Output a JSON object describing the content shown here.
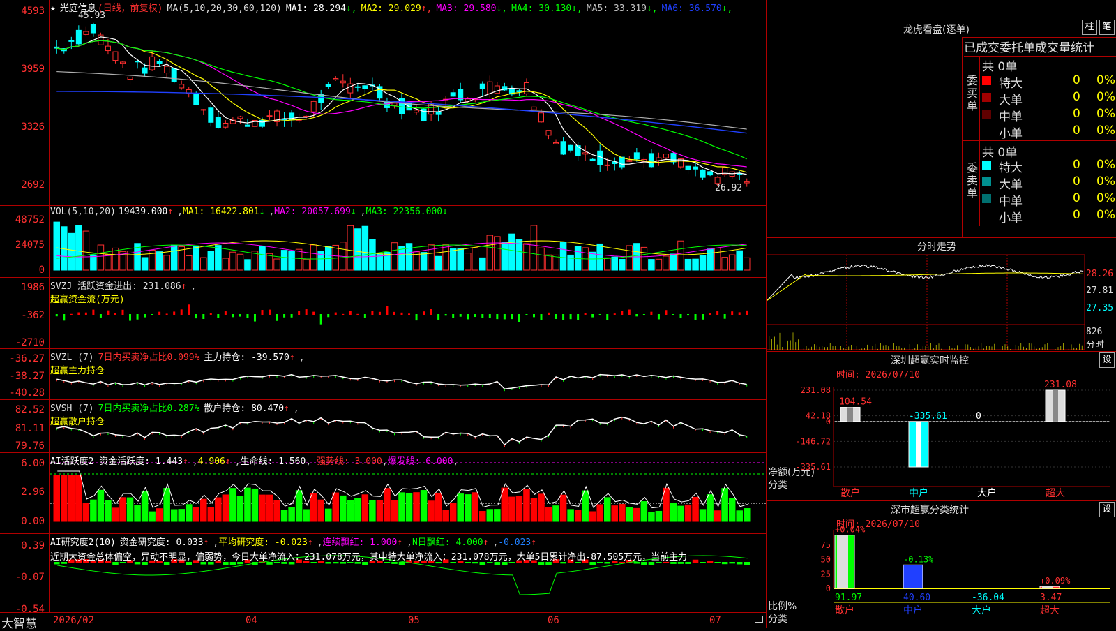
{
  "main": {
    "stock_name": "光庭信息",
    "mode": "(日线，前复权)",
    "ma_label": "MA(5,10,20,30,60,120)",
    "ma": [
      {
        "label": "MA1:",
        "value": "28.294",
        "arrow": "↓",
        "color": "#ffffff"
      },
      {
        "label": "MA2:",
        "value": "29.029",
        "arrow": "↑",
        "color": "#ffff00"
      },
      {
        "label": "MA3:",
        "value": "29.580",
        "arrow": "↓",
        "color": "#ff00ff"
      },
      {
        "label": "MA4:",
        "value": "30.130",
        "arrow": "↓",
        "color": "#00ff00"
      },
      {
        "label": "MA5:",
        "value": "33.319",
        "arrow": "↓",
        "color": "#c0c0c0"
      },
      {
        "label": "MA6:",
        "value": "36.570",
        "arrow": "↓",
        "color": "#2040ff"
      }
    ],
    "price_ticks": [
      "4593",
      "3959",
      "3326",
      "2692"
    ],
    "high_label": "45.93",
    "low_label": "26.92"
  },
  "vol": {
    "label": "VOL(5,10,20)",
    "value": "19439.000",
    "ma1": "MA1: 16422.801",
    "ma2": "MA2: 20057.699",
    "ma3": "MA3: 22356.000",
    "ticks": [
      "48752",
      "24075",
      "0"
    ]
  },
  "svzj": {
    "label": "SVZJ  活跃资金进出: 231.086",
    "sub": "超赢资金流(万元)",
    "ticks": [
      "1986",
      "-362",
      "-2710"
    ]
  },
  "svzl": {
    "label": "SVZL (7)",
    "mid": "7日内买卖净占比0.099%",
    "right": "主力持仓: -39.570",
    "sub": "超赢主力持仓",
    "ticks": [
      "-36.27",
      "-38.27",
      "-40.28"
    ]
  },
  "svsh": {
    "label": "SVSH (7)",
    "mid": "7日内买卖净占比0.287%",
    "right": "散户持仓: 80.470",
    "sub": "超赢散户持仓",
    "ticks": [
      "82.52",
      "81.11",
      "79.76"
    ]
  },
  "ai1": {
    "label": "AI活跃度2 资金活跃度: 1.443",
    "v2": "4.906",
    "life": "生命线: 1.560",
    "strong": "强势线: 3.000",
    "burst": "爆发线: 6.000",
    "ticks": [
      "6.00",
      "2.96",
      "0.00"
    ]
  },
  "ai2": {
    "label": "AI研究度2(10)",
    "study": "资金研究度: 0.033",
    "avg": "平均研究度: -0.023",
    "red": "连续飘红: 1.000",
    "nred": "N日飘红: 4.000",
    "last": "-0.023",
    "comment": "近期大资金总体偏空，异动不明显，偏弱势，今日大单净流入：231.078万元，其中特大单净流入：231.078万元，大单5日累计净出-87.505万元，当前主力",
    "ticks": [
      "0.39",
      "-0.07",
      "-0.54"
    ]
  },
  "bottom": {
    "brand": "大智慧",
    "dates": [
      "2026/02",
      "04",
      "05",
      "06",
      "07"
    ]
  },
  "lhb": {
    "title": "龙虎看盘(逐单)",
    "btn1": "柱",
    "btn2": "笔",
    "header": "已成交委托单成交量统计",
    "buy_side": "委买单",
    "sell_side": "委卖单",
    "buy_total": "共 0单",
    "sell_total": "共 0单",
    "buy_rows": [
      {
        "name": "特大",
        "qty": "0",
        "pct": "0%",
        "color": "#ff0000"
      },
      {
        "name": "大单",
        "qty": "0",
        "pct": "0%",
        "color": "#a00000"
      },
      {
        "name": "中单",
        "qty": "0",
        "pct": "0%",
        "color": "#600000"
      },
      {
        "name": "小单",
        "qty": "0",
        "pct": "0%",
        "color": ""
      }
    ],
    "sell_rows": [
      {
        "name": "特大",
        "qty": "0",
        "pct": "0%",
        "color": "#00ffff"
      },
      {
        "name": "大单",
        "qty": "0",
        "pct": "0%",
        "color": "#009090"
      },
      {
        "name": "中单",
        "qty": "0",
        "pct": "0%",
        "color": "#007070"
      },
      {
        "name": "小单",
        "qty": "0",
        "pct": "0%",
        "color": ""
      }
    ]
  },
  "fenshi": {
    "title": "分时走势",
    "ticks": [
      "28.26",
      "27.81",
      "27.35"
    ],
    "vol_tick": "826",
    "vol_label": "分时"
  },
  "sz_monitor": {
    "title": "深圳超赢实时监控",
    "btn": "设",
    "time": "时间: 2026/07/10",
    "ticks": [
      "231.08",
      "42.18",
      "0",
      "-146.72",
      "-335.61"
    ],
    "y_label1": "净额(万元)",
    "y_label2": "分类",
    "bars": [
      {
        "cat": "散户",
        "label": "104.54",
        "value": 104.54
      },
      {
        "cat": "中户",
        "label": "-335.61",
        "value": -335.61
      },
      {
        "cat": "大户",
        "label": "0",
        "value": 0
      },
      {
        "cat": "超大",
        "label": "231.08",
        "value": 231.08
      }
    ]
  },
  "sz_class": {
    "title": "深市超赢分类统计",
    "btn": "设",
    "time": "时间: 2026/07/10",
    "ticks": [
      "75",
      "50",
      "25",
      "0"
    ],
    "y_label1": "比例%",
    "y_label2": "分类",
    "bars": [
      {
        "cat": "散户",
        "top": "+0.04%",
        "bottom": "91.97",
        "value": 91.97
      },
      {
        "cat": "中户",
        "top": "-0.13%",
        "bottom": "40.60",
        "value": 40.6
      },
      {
        "cat": "大户",
        "top": "",
        "bottom": "-36.04",
        "value": -36.04
      },
      {
        "cat": "超大",
        "top": "+0.09%",
        "bottom": "3.47",
        "value": 3.47
      }
    ]
  }
}
